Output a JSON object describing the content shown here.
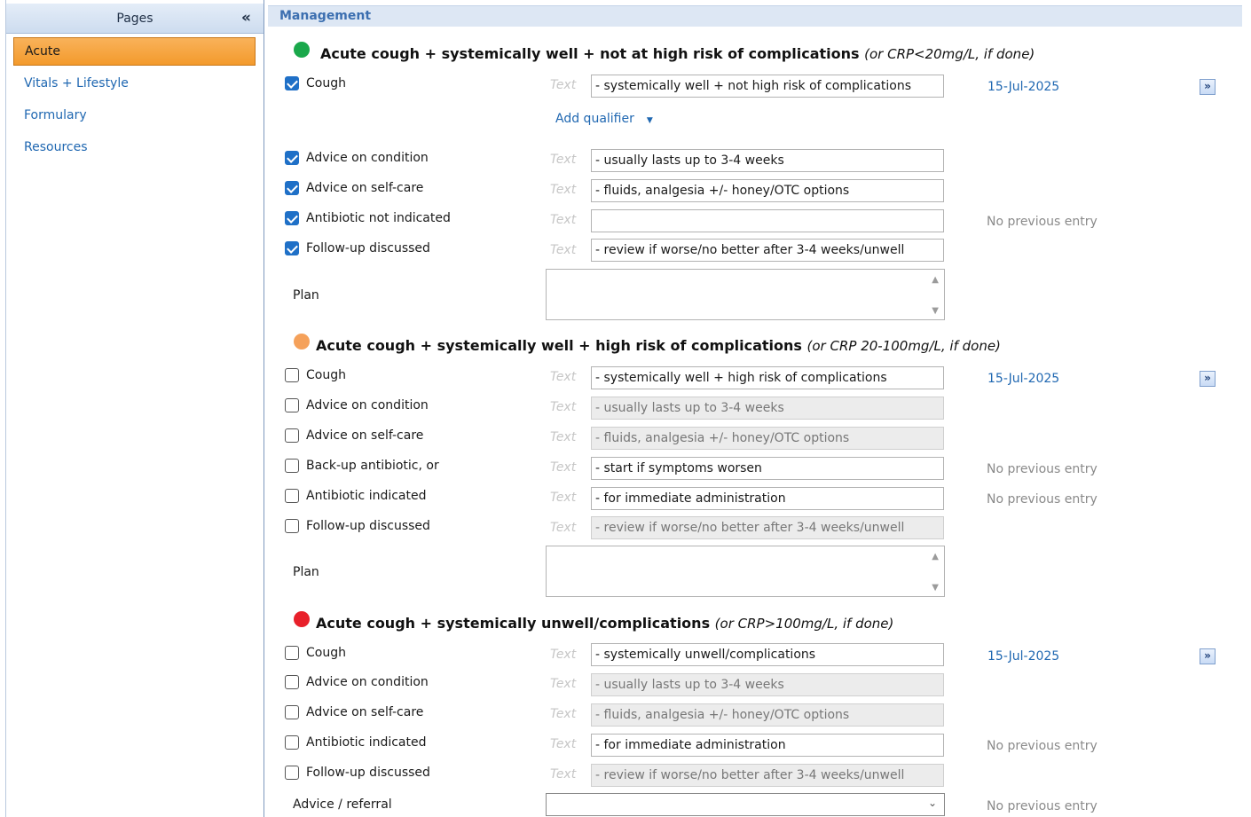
{
  "sidebar": {
    "header": "Pages",
    "collapse_icon": "«",
    "items": [
      {
        "label": "Acute",
        "active": true
      },
      {
        "label": "Vitals + Lifestyle",
        "active": false
      },
      {
        "label": "Formulary",
        "active": false
      },
      {
        "label": "Resources",
        "active": false
      }
    ]
  },
  "main": {
    "section_header": "Management",
    "text_hint": "Text",
    "add_qualifier": "Add qualifier",
    "plan_label": "Plan",
    "advice_referral_label": "Advice / referral",
    "sections": [
      {
        "title": "Acute cough + systemically well + not at high risk of complications",
        "note": "(or CRP<20mg/L, if done)",
        "dot_color": "#1aa84b",
        "rows": [
          {
            "label": "Cough",
            "checked": true,
            "value": "- systemically well + not high risk of complications",
            "disabled": false,
            "date": "15-Jul-2025"
          },
          {
            "label": "Advice on condition",
            "checked": true,
            "value": "- usually lasts up to 3-4 weeks",
            "disabled": false
          },
          {
            "label": "Advice on self-care",
            "checked": true,
            "value": "- fluids, analgesia +/- honey/OTC options",
            "disabled": false
          },
          {
            "label": "Antibiotic not indicated",
            "checked": true,
            "value": "",
            "disabled": false,
            "prev": "No previous entry"
          },
          {
            "label": "Follow-up discussed",
            "checked": true,
            "value": "- review if worse/no better after 3-4 weeks/unwell",
            "disabled": false
          }
        ]
      },
      {
        "title": "Acute cough + systemically well + high risk of complications",
        "note": "(or CRP 20-100mg/L, if done)",
        "dot_color": "#f5a15a",
        "rows": [
          {
            "label": "Cough",
            "checked": false,
            "value": "- systemically well + high risk of complications",
            "disabled": false,
            "date": "15-Jul-2025"
          },
          {
            "label": "Advice on condition",
            "checked": false,
            "value": "- usually lasts up to 3-4 weeks",
            "disabled": true
          },
          {
            "label": "Advice on self-care",
            "checked": false,
            "value": "- fluids, analgesia +/- honey/OTC options",
            "disabled": true
          },
          {
            "label": "Back-up antibiotic, or",
            "checked": false,
            "value": "- start if symptoms worsen",
            "disabled": false,
            "prev": "No previous entry"
          },
          {
            "label": "Antibiotic indicated",
            "checked": false,
            "value": "- for immediate administration",
            "disabled": false,
            "prev": "No previous entry"
          },
          {
            "label": "Follow-up discussed",
            "checked": false,
            "value": "- review if worse/no better after 3-4 weeks/unwell",
            "disabled": true
          }
        ]
      },
      {
        "title": "Acute cough + systemically unwell/complications",
        "note": "(or CRP>100mg/L, if done)",
        "dot_color": "#e8202a",
        "rows": [
          {
            "label": "Cough",
            "checked": false,
            "value": "- systemically unwell/complications",
            "disabled": false,
            "date": "15-Jul-2025"
          },
          {
            "label": "Advice on condition",
            "checked": false,
            "value": "- usually lasts up to 3-4 weeks",
            "disabled": true
          },
          {
            "label": "Advice on self-care",
            "checked": false,
            "value": "- fluids, analgesia +/- honey/OTC options",
            "disabled": true
          },
          {
            "label": "Antibiotic indicated",
            "checked": false,
            "value": "- for immediate administration",
            "disabled": false,
            "prev": "No previous entry"
          },
          {
            "label": "Follow-up discussed",
            "checked": false,
            "value": "- review if worse/no better after 3-4 weeks/unwell",
            "disabled": true
          }
        ],
        "advice_prev": "No previous entry"
      }
    ]
  }
}
